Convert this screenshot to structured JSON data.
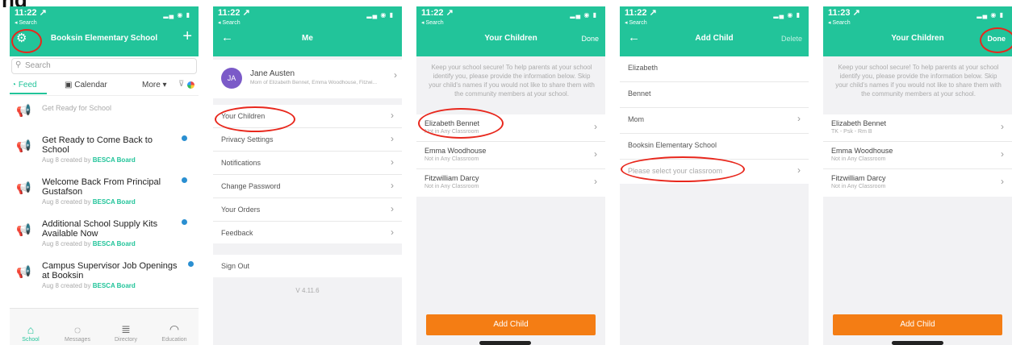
{
  "heading": "ng",
  "brand_color": "#22c49a",
  "accent_color": "#f47d14",
  "screen1": {
    "time": "11:22 ↗",
    "back": "◂ Search",
    "title": "Booksin Elementary School",
    "search_placeholder": "Search",
    "tab_feed": "Feed",
    "tab_calendar": "Calendar",
    "tab_more": "More ▾",
    "items": [
      {
        "title": "Get Ready for School",
        "meta_prefix": "",
        "meta_author": ""
      },
      {
        "title": "Get Ready to Come Back to School",
        "meta_prefix": "Aug 8 created by ",
        "meta_author": "BESCA Board"
      },
      {
        "title": "Welcome Back From Principal Gustafson",
        "meta_prefix": "Aug 8 created by ",
        "meta_author": "BESCA Board"
      },
      {
        "title": "Additional School Supply Kits Available Now",
        "meta_prefix": "Aug 8 created by ",
        "meta_author": "BESCA Board"
      },
      {
        "title": "Campus Supervisor Job Openings at Booksin",
        "meta_prefix": "Aug 8 created by ",
        "meta_author": "BESCA Board"
      }
    ],
    "tabs": [
      "School",
      "Messages",
      "Directory",
      "Education"
    ]
  },
  "screen2": {
    "time": "11:22 ↗",
    "back": "◂ Search",
    "title": "Me",
    "avatar": "JA",
    "name": "Jane Austen",
    "sub": "Mom of Elizabeth Bennet, Emma Woodhouse, Fitzwi...",
    "menu": [
      "Your Children",
      "Privacy Settings",
      "Notifications",
      "Change Password",
      "Your Orders",
      "Feedback"
    ],
    "signout": "Sign Out",
    "version": "V 4.11.6"
  },
  "screen3": {
    "time": "11:22 ↗",
    "back": "◂ Search",
    "title": "Your Children",
    "done": "Done",
    "intro": "Keep your school secure! To help parents at your school identify you, please provide the information below. Skip your child's names if you would not like to share them with the community members at your school.",
    "kids": [
      {
        "name": "Elizabeth Bennet",
        "status": "Not in Any Classroom"
      },
      {
        "name": "Emma Woodhouse",
        "status": "Not in Any Classroom"
      },
      {
        "name": "Fitzwilliam Darcy",
        "status": "Not in Any Classroom"
      }
    ],
    "add": "Add Child"
  },
  "screen4": {
    "time": "11:22 ↗",
    "back": "◂ Search",
    "title": "Add Child",
    "delete": "Delete",
    "fields": [
      "Elizabeth",
      "Bennet",
      "Mom",
      "Booksin Elementary School",
      "Please select your classroom"
    ]
  },
  "screen5": {
    "time": "11:23 ↗",
    "back": "◂ Search",
    "title": "Your Children",
    "done": "Done",
    "intro": "Keep your school secure! To help parents at your school identify you, please provide the information below. Skip your child's names if you would not like to share them with the community members at your school.",
    "kids": [
      {
        "name": "Elizabeth Bennet",
        "status": "TK - Psk - Rm B"
      },
      {
        "name": "Emma Woodhouse",
        "status": "Not in Any Classroom"
      },
      {
        "name": "Fitzwilliam Darcy",
        "status": "Not in Any Classroom"
      }
    ],
    "add": "Add Child"
  }
}
